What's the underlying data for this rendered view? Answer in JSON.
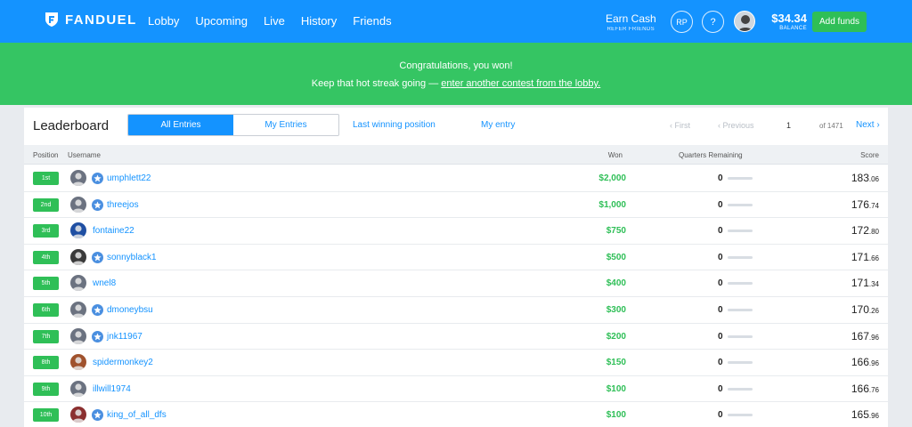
{
  "header": {
    "logo_text": "FANDUEL",
    "nav": [
      "Lobby",
      "Upcoming",
      "Live",
      "History",
      "Friends"
    ],
    "earn_cash": "Earn Cash",
    "refer_friends": "REFER FRIENDS",
    "rp_label": "RP",
    "help_label": "?",
    "balance": "$34.34",
    "balance_label": "BALANCE",
    "add_funds": "Add funds"
  },
  "banner": {
    "line1": "Congratulations, you won!",
    "line2_prefix": "Keep that hot streak going — ",
    "line2_link": "enter another contest from the lobby."
  },
  "leaderboard": {
    "title": "Leaderboard",
    "tabs": [
      "All Entries",
      "My Entries"
    ],
    "active_tab": "All Entries",
    "last_winning": "Last winning position",
    "my_entry": "My entry",
    "pagination": {
      "first": "‹ First",
      "previous": "‹ Previous",
      "page": "1",
      "of": "of 1471",
      "next": "Next ›"
    },
    "columns": {
      "position": "Position",
      "username": "Username",
      "won": "Won",
      "quarters": "Quarters Remaining",
      "score": "Score"
    },
    "rows": [
      {
        "pos": "1st",
        "user": "umphlett22",
        "star": true,
        "won": "$2,000",
        "q": "0",
        "score_int": "183",
        "score_dec": ".06",
        "avatar": "#6b7280"
      },
      {
        "pos": "2nd",
        "user": "threejos",
        "star": true,
        "won": "$1,000",
        "q": "0",
        "score_int": "176",
        "score_dec": ".74",
        "avatar": "#6b7280"
      },
      {
        "pos": "3rd",
        "user": "fontaine22",
        "star": false,
        "won": "$750",
        "q": "0",
        "score_int": "172",
        "score_dec": ".80",
        "avatar": "#1f4fa3"
      },
      {
        "pos": "4th",
        "user": "sonnyblack1",
        "star": true,
        "won": "$500",
        "q": "0",
        "score_int": "171",
        "score_dec": ".66",
        "avatar": "#3a3a3a"
      },
      {
        "pos": "5th",
        "user": "wnel8",
        "star": false,
        "won": "$400",
        "q": "0",
        "score_int": "171",
        "score_dec": ".34",
        "avatar": "#6b7280"
      },
      {
        "pos": "6th",
        "user": "dmoneybsu",
        "star": true,
        "won": "$300",
        "q": "0",
        "score_int": "170",
        "score_dec": ".26",
        "avatar": "#6b7280"
      },
      {
        "pos": "7th",
        "user": "jnk11967",
        "star": true,
        "won": "$200",
        "q": "0",
        "score_int": "167",
        "score_dec": ".96",
        "avatar": "#6b7280"
      },
      {
        "pos": "8th",
        "user": "spidermonkey2",
        "star": false,
        "won": "$150",
        "q": "0",
        "score_int": "166",
        "score_dec": ".96",
        "avatar": "#a0522d"
      },
      {
        "pos": "9th",
        "user": "illwill1974",
        "star": false,
        "won": "$100",
        "q": "0",
        "score_int": "166",
        "score_dec": ".76",
        "avatar": "#6b7280"
      },
      {
        "pos": "10th",
        "user": "king_of_all_dfs",
        "star": true,
        "won": "$100",
        "q": "0",
        "score_int": "165",
        "score_dec": ".96",
        "avatar": "#8b2f2f"
      }
    ]
  },
  "colors": {
    "brand_blue": "#1493ff",
    "win_green": "#35c563"
  }
}
